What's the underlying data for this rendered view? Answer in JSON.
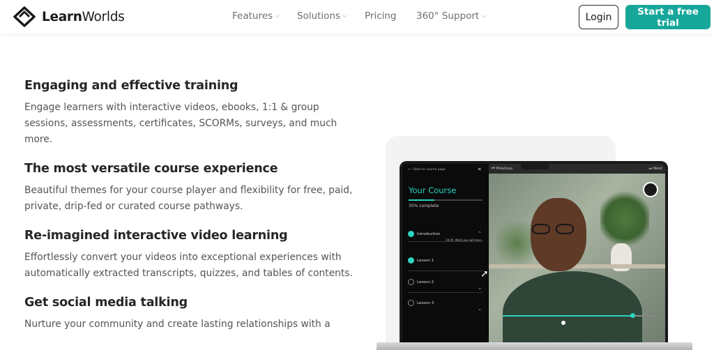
{
  "header": {
    "logo": {
      "bold": "Learn",
      "regular": "Worlds"
    },
    "nav": [
      {
        "label": "Features",
        "dropdown": true
      },
      {
        "label": "Solutions",
        "dropdown": true
      },
      {
        "label": "Pricing",
        "dropdown": false
      },
      {
        "label": "360° Support",
        "dropdown": true
      }
    ],
    "login_label": "Login",
    "trial_label": "Start a free trial"
  },
  "features": [
    {
      "title": "Engaging and effective training",
      "text": "Engage learners with interactive videos, ebooks, 1:1 & group sessions, assessments, certificates, SCORMs, surveys, and much more."
    },
    {
      "title": "The most versatile course experience",
      "text": "Beautiful themes for your course player and flexibility for free, paid, private, drip-fed or curated course pathways."
    },
    {
      "title": "Re-imagined interactive video learning",
      "text": "Effortlessly convert your videos into exceptional experiences with automatically extracted transcripts, quizzes, and tables of contents."
    },
    {
      "title": "Get social media talking",
      "text": "Nurture your community and create lasting relationships with a"
    }
  ],
  "player": {
    "back": "Back to course page",
    "course_title": "Your Course",
    "progress_pct": 35,
    "progress_text": "35% complete",
    "lessons": [
      {
        "label": "Introduction",
        "sub": "What you will learn",
        "time": "10:45",
        "done": true
      },
      {
        "label": "Lesson 1",
        "done": true
      },
      {
        "label": "Lesson 2",
        "done": false
      },
      {
        "label": "Lesson 3",
        "done": false
      }
    ],
    "prev_label": "Previous",
    "next_label": "Next",
    "seek_fraction": 0.85
  },
  "colors": {
    "accent": "#16a79a",
    "player_accent": "#2bd4c0"
  }
}
